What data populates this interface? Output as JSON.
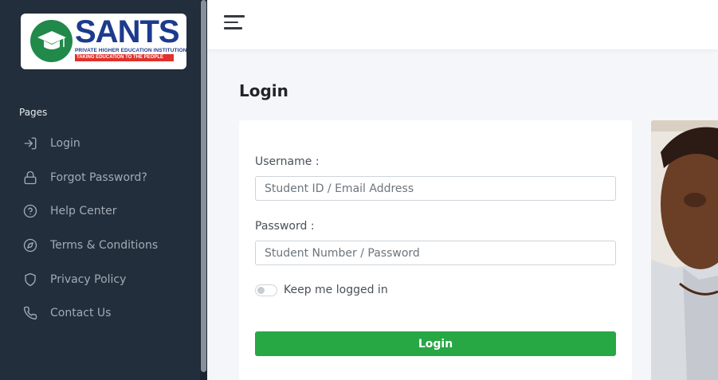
{
  "brand": {
    "name": "SANTS",
    "subtitle": "PRIVATE HIGHER EDUCATION INSTITUTION",
    "tagline": "TAKING EDUCATION TO THE PEOPLE",
    "green": "#21894a",
    "blue": "#1d3b8d",
    "red": "#e0322c"
  },
  "sidebar": {
    "section_label": "Pages",
    "items": [
      {
        "label": "Login",
        "icon": "log-in-icon"
      },
      {
        "label": "Forgot Password?",
        "icon": "lock-icon"
      },
      {
        "label": "Help Center",
        "icon": "help-circle-icon"
      },
      {
        "label": "Terms & Conditions",
        "icon": "compass-icon"
      },
      {
        "label": "Privacy Policy",
        "icon": "shield-icon"
      },
      {
        "label": "Contact Us",
        "icon": "phone-icon"
      }
    ]
  },
  "page": {
    "title": "Login"
  },
  "form": {
    "username_label": "Username :",
    "username_placeholder": "Student ID / Email Address",
    "password_label": "Password :",
    "password_placeholder": "Student Number / Password",
    "remember_label": "Keep me logged in",
    "remember_checked": false,
    "submit_label": "Login"
  },
  "colors": {
    "sidebar_bg": "#222e3c",
    "primary_button": "#28a745"
  }
}
